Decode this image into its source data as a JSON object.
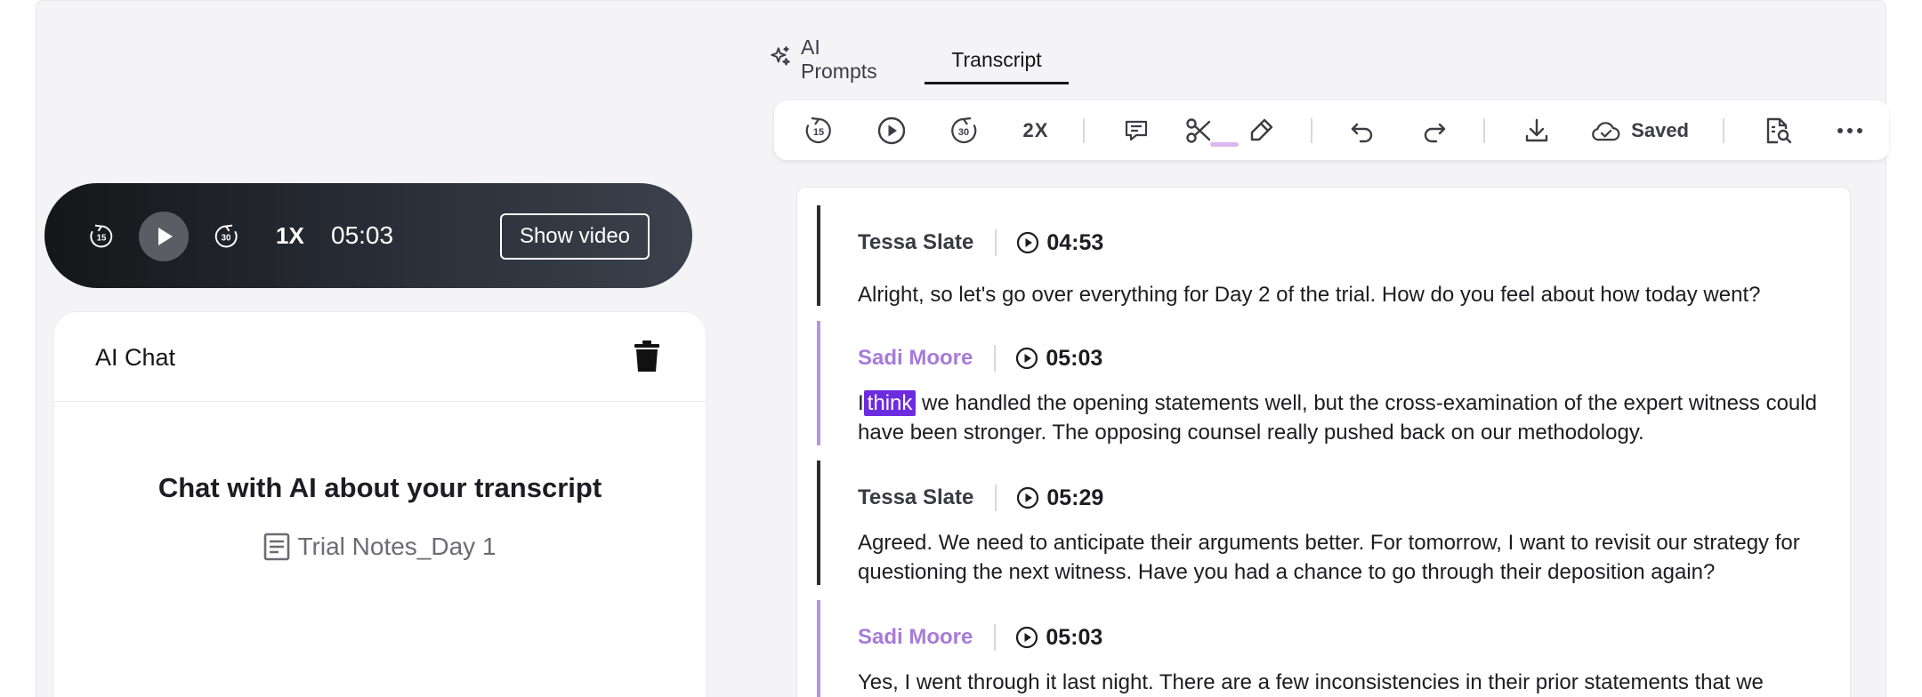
{
  "tabs": {
    "ai_prompts": "AI Prompts",
    "transcript": "Transcript"
  },
  "toolbar": {
    "rewind_seconds": "15",
    "forward_seconds": "30",
    "speed": "2X",
    "saved_label": "Saved"
  },
  "player": {
    "rewind_seconds": "15",
    "forward_seconds": "30",
    "speed": "1X",
    "time": "05:03",
    "show_video_label": "Show video"
  },
  "chat": {
    "title": "AI Chat",
    "heading": "Chat with AI about your transcript",
    "file_name": "Trial Notes_Day 1"
  },
  "transcript": {
    "entries": [
      {
        "speaker": "Tessa Slate",
        "time": "04:53",
        "text": "Alright, so let's go over everything for Day 2 of the trial. How do you feel about how today went?"
      },
      {
        "speaker": "Sadi Moore",
        "time": "05:03",
        "text_before": "I",
        "text_highlight": "think",
        "text_after": "we handled the opening statements well, but the cross-examination of the expert witness could have been stronger. The opposing counsel really pushed back on our methodology."
      },
      {
        "speaker": "Tessa Slate",
        "time": "05:29",
        "text": "Agreed. We need to anticipate their arguments better. For tomorrow, I want to revisit our strategy for questioning the next witness. Have you had a chance to go through their deposition again?"
      },
      {
        "speaker": "Sadi Moore",
        "time": "05:03",
        "text": "Yes, I went through it last night. There are a few inconsistencies in their prior statements that we"
      }
    ]
  },
  "colors": {
    "accent_purple": "#a77bd8",
    "highlight": "#6d2be0"
  }
}
